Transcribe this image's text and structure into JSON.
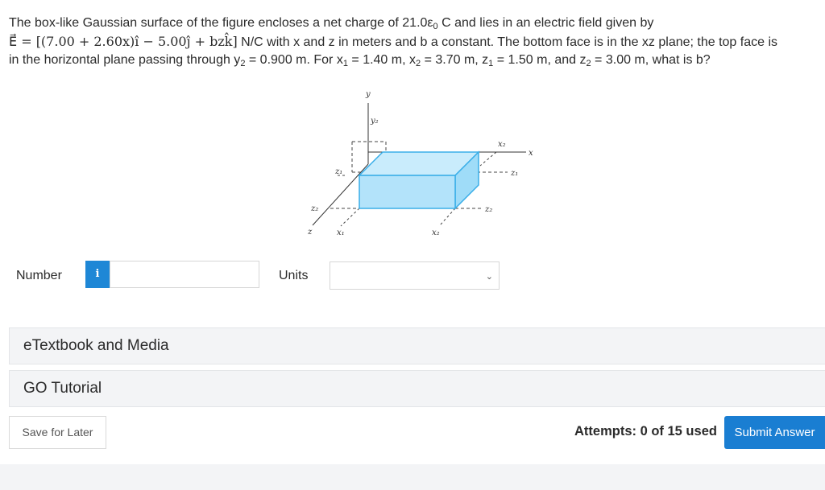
{
  "question": {
    "line1_part1": "The box-like Gaussian surface of the figure encloses a net charge of 21.0ε",
    "line1_sub0": "0",
    "line1_part2": " C and lies in an electric field given by",
    "line2_math": "E⃗ = [(7.00 + 2.60x)î − 5.00ĵ + bzk̂]",
    "line2_text": " N/C with x and z in meters and b a constant. The bottom face is in the xz plane; the top face is",
    "line3_a": "in the horizontal plane passing through y",
    "line3_b": " = 0.900 m. For x",
    "line3_c": " = 1.40 m, x",
    "line3_d": " = 3.70 m, z",
    "line3_e": " = 1.50 m, and z",
    "line3_f": " = 3.00 m, what is b?",
    "sub2": "2",
    "sub1": "1"
  },
  "figure": {
    "y_axis": "y",
    "x_axis": "x",
    "z_axis": "z",
    "y2": "y₂",
    "x1": "x₁",
    "x2_bottom": "x₂",
    "x2_top": "x₂",
    "z1_left": "z₁",
    "z1_right": "z₁",
    "z2_left": "z₂",
    "z2_right": "z₂"
  },
  "answer": {
    "number_label": "Number",
    "info_icon": "i",
    "number_value": "",
    "units_label": "Units",
    "units_value": ""
  },
  "panels": {
    "etextbook": "eTextbook and Media",
    "go_tutorial": "GO Tutorial"
  },
  "footer": {
    "save_label": "Save for Later",
    "attempts": "Attempts: 0 of 15 used",
    "submit_label": "Submit Answer"
  },
  "colors": {
    "accent": "#1a7ed2",
    "info": "#1e87d6",
    "box_fill": "#bfe6fa",
    "box_stroke": "#3aaee8"
  }
}
